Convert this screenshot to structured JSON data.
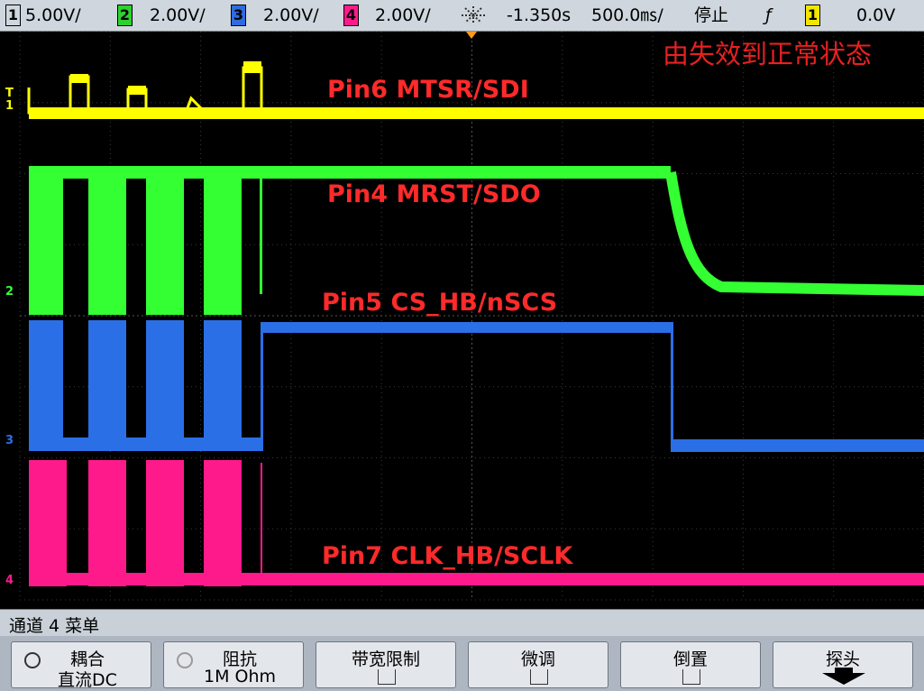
{
  "topbar": {
    "channels": [
      {
        "num": "1",
        "scale": "5.00V/",
        "color": "#f2e600"
      },
      {
        "num": "2",
        "scale": "2.00V/",
        "color": "#2ed12e"
      },
      {
        "num": "3",
        "scale": "2.00V/",
        "color": "#2f6be0"
      },
      {
        "num": "4",
        "scale": "2.00V/",
        "color": "#ff1a8c"
      }
    ],
    "time_offset": "-1.350s",
    "time_scale": "500.0㎳/",
    "run_state": "停止",
    "trigger_symbol": "ƒ",
    "trigger_channel": "1",
    "trigger_level": "0.0V",
    "trigger_icon": "trigger-position-icon"
  },
  "screen": {
    "title_annotation": "由失效到正常状态",
    "labels": {
      "ch1": "Pin6 MTSR/SDI",
      "ch2": "Pin4 MRST/SDO",
      "ch3": "Pin5 CS_HB/nSCS",
      "ch4": "Pin7 CLK_HB/SCLK"
    },
    "markers": {
      "ch1": "1",
      "ch2": "2",
      "ch3": "3",
      "ch4": "4",
      "trig": "T"
    },
    "colors": {
      "ch1": "#ffff00",
      "ch2": "#33ff33",
      "ch3": "#2b6fe6",
      "ch4": "#ff1a8c",
      "label": "#ff2a2a",
      "title": "#e82020"
    }
  },
  "menubar": {
    "title": "通道 4 菜单"
  },
  "softkeys": [
    {
      "line1": "耦合",
      "line2": "直流DC"
    },
    {
      "line1": "阻抗",
      "line2": "1M Ohm"
    },
    {
      "line1": "带宽限制",
      "line2": ""
    },
    {
      "line1": "微调",
      "line2": ""
    },
    {
      "line1": "倒置",
      "line2": ""
    },
    {
      "line1": "探头",
      "line2": ""
    }
  ]
}
